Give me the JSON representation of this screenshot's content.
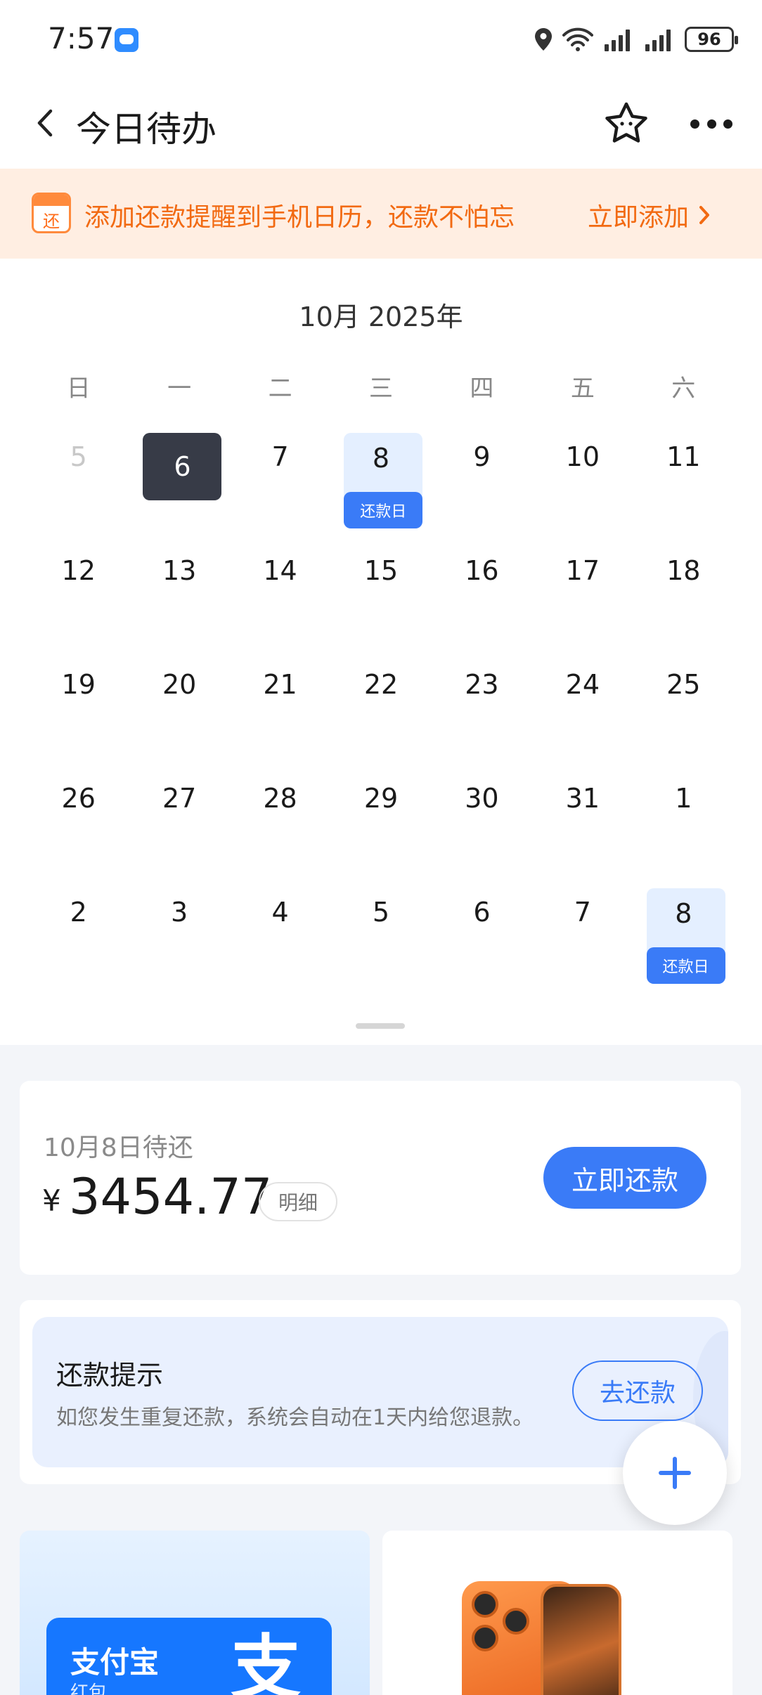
{
  "status_bar": {
    "time": "7:57",
    "battery": "96"
  },
  "header": {
    "title": "今日待办"
  },
  "banner": {
    "icon_text": "还",
    "text": "添加还款提醒到手机日历，还款不怕忘",
    "action": "立即添加"
  },
  "calendar": {
    "month_title": "10月 2025年",
    "weekdays": [
      "日",
      "一",
      "二",
      "三",
      "四",
      "五",
      "六"
    ],
    "repay_tag": "还款日",
    "days": [
      "5",
      "6",
      "7",
      "8",
      "9",
      "10",
      "11",
      "12",
      "13",
      "14",
      "15",
      "16",
      "17",
      "18",
      "19",
      "20",
      "21",
      "22",
      "23",
      "24",
      "25",
      "26",
      "27",
      "28",
      "29",
      "30",
      "31",
      "1",
      "2",
      "3",
      "4",
      "5",
      "6",
      "7",
      "8"
    ]
  },
  "due": {
    "label": "10月8日待还",
    "currency": "¥",
    "amount": "3454.77",
    "detail": "明细",
    "pay_button": "立即还款"
  },
  "tip": {
    "title": "还款提示",
    "desc": "如您发生重复还款，系统会自动在1天内给您退款。",
    "button": "去还款"
  },
  "promo": {
    "alipay_name": "支付宝",
    "alipay_sub": "红包",
    "alipay_logo": "支"
  },
  "colors": {
    "accent": "#3a7bf7",
    "banner_text": "#f26a12",
    "selected_day": "#373b47"
  }
}
